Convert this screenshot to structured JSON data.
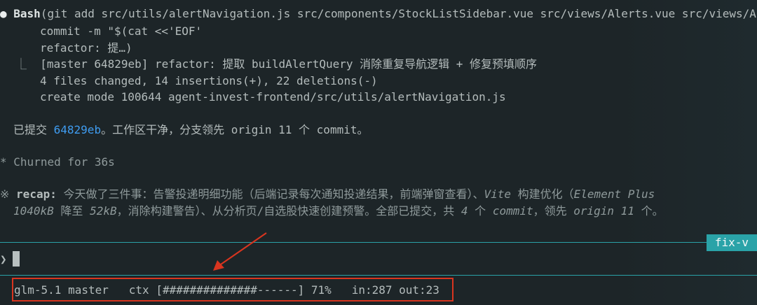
{
  "bash_call": {
    "bullet": "●",
    "tool": "Bash",
    "args": "(git add src/utils/alertNavigation.js src/components/StockListSidebar.vue src/views/Alerts.vue src/views/A",
    "cmd_line1": "commit -m \"$(cat <<'EOF'",
    "cmd_line2": "refactor: 提…)",
    "result_glyph": "⎿",
    "result_line1": "[master 64829eb] refactor: 提取 buildAlertQuery 消除重复导航逻辑 + 修复预填顺序",
    "result_line2": "4 files changed, 14 insertions(+), 22 deletions(-)",
    "result_line3": "create mode 100644 agent-invest-frontend/src/utils/alertNavigation.js"
  },
  "committed": {
    "prefix": "已提交 ",
    "hash": "64829eb",
    "suffix": "。工作区干净，分支领先 origin 11 个 commit。"
  },
  "churned": {
    "glyph": "*",
    "text": "Churned for 36s"
  },
  "recap": {
    "glyph": "※",
    "label": "recap:",
    "line1_a": " 今天做了三件事：告警投递明细功能（后端记录每次通知投递结果，前端弹窗查看）、",
    "line1_b": "Vite",
    "line1_c": " 构建优化（",
    "line1_d": "Element Plus",
    "line2_a": "1040kB",
    "line2_b": " 降至 ",
    "line2_c": "52kB",
    "line2_d": "，消除构建警告）、从分析页/自选股快速创建预警。全部已提交，共 ",
    "line2_e": "4",
    "line2_f": " 个 ",
    "line2_g": "commit",
    "line2_h": "，领先 ",
    "line2_i": "origin 11",
    "line2_j": " 个。"
  },
  "branch_tag": "fix-v",
  "prompt": {
    "chevron": "❯"
  },
  "status_bar": {
    "model": "glm-5.1",
    "branch": "master",
    "ctx_label": "ctx",
    "ctx_bar": "[##############------]",
    "ctx_percent": "71%",
    "in_label": "in:287",
    "out_label": "out:23",
    "ctx_fraction": 0.71
  },
  "colors": {
    "background": "#1d2528",
    "accent_teal": "#2aa3a8",
    "hash_blue": "#3f9cf0",
    "annotation_red": "#d9351f"
  }
}
